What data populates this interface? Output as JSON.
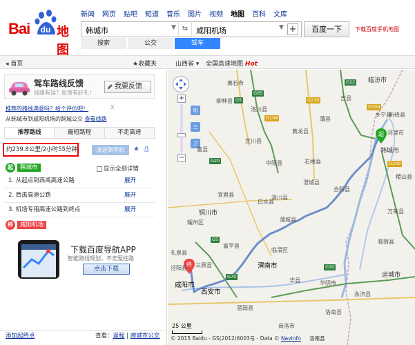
{
  "logo": {
    "bai": "Bai",
    "du": "du",
    "ditu": "地图"
  },
  "topnav": [
    "新闻",
    "网页",
    "贴吧",
    "知道",
    "音乐",
    "图片",
    "视频",
    "地图",
    "百科",
    "文库"
  ],
  "topnav_current": "地图",
  "search": {
    "from": "韩城市",
    "to": "咸阳机场",
    "button": "百度一下"
  },
  "download_link": "下载百度手机地图",
  "mode_tabs": [
    "搜索",
    "公交",
    "驾车"
  ],
  "mode_active": "驾车",
  "bar": {
    "home": "首页",
    "fav": "收藏夹",
    "province": "山西省",
    "gaosu": "全国高速地图",
    "hot": "Hot"
  },
  "feedback": {
    "title": "驾车路线反馈",
    "subtitle": "线路有误？反馈有好礼！",
    "button": "我要反馈"
  },
  "ask": {
    "text": "推荐的路线满意吗？给个评价吧！",
    "close": "X"
  },
  "via": {
    "text": "从韩城市到咸阳机场的",
    "link_prefix": "跨城公交",
    "link": "查看线路"
  },
  "route_tabs": [
    "推荐路线",
    "最短路程",
    "不走高速"
  ],
  "distance": "约239.8公里/2小时55分钟",
  "send_button": "发送到手机",
  "start": {
    "badge": "起",
    "place": "韩城市"
  },
  "show_all": "显示全部详情",
  "steps": [
    {
      "text": "1. 从起点到西禹高速公路",
      "action": "展开"
    },
    {
      "text": "2. 西禹高速公路",
      "action": "展开"
    },
    {
      "text": "3. 机场专用高速公路到终点",
      "action": "展开"
    }
  ],
  "end": {
    "badge": "终",
    "place": "咸阳机场"
  },
  "ad": {
    "headline": "下载百度导航APP",
    "sub": "智能路线规划，不走冤枉路",
    "button": "点击下载"
  },
  "footer": {
    "left": "添加起终点",
    "see": "查看：",
    "link1": "返程",
    "sep": "|",
    "link2": "跨城市公交"
  },
  "map": {
    "tags": [
      "街",
      "三",
      "卫"
    ],
    "places": [
      "离石市",
      "柳林县",
      "洛川县",
      "黄龙县",
      "临汾市",
      "中阳县",
      "宜川县",
      "石楼县",
      "吉县",
      "乡宁县",
      "韩城市",
      "蒲县",
      "富县",
      "洛川县",
      "宜君县",
      "合阳县",
      "澄城县",
      "白水县",
      "蒲城县",
      "铜川市",
      "耀州区",
      "富平县",
      "临渭区",
      "渭南市",
      "三原县",
      "咸阳市",
      "西安市",
      "华县",
      "华阴市",
      "运城市",
      "永济县",
      "临猗县",
      "万荣县",
      "河津市",
      "稷山县",
      "洛南县",
      "蓝田县",
      "商洛市",
      "礼泉县",
      "泾阳县",
      "新绛县"
    ],
    "shields": [
      "G65",
      "G22",
      "G20",
      "G5",
      "G108",
      "G209",
      "G309",
      "G210",
      "G5",
      "G30",
      "G70"
    ],
    "scale": "25 公里",
    "copyright": "© 2015 Baidu - GS(2012)6003号 - Data ©",
    "copyright_link": "NavInfo",
    "bottom_place": "洛南县"
  },
  "colors": {
    "brand_red": "#e10601",
    "accent_blue": "#3385ff",
    "link": "#0b3399",
    "route": "#6c8ec7"
  }
}
